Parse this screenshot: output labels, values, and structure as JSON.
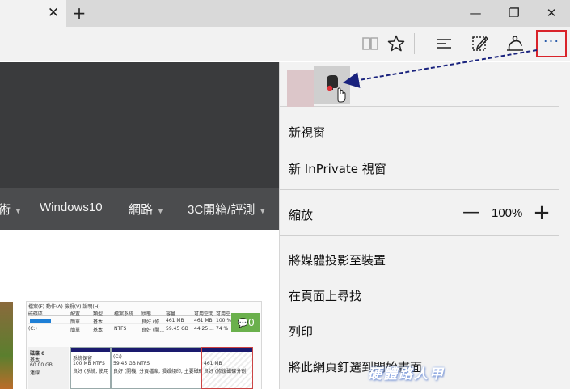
{
  "tabbar": {
    "close_glyph": "✕",
    "new_tab_glyph": "+",
    "minimize_glyph": "—",
    "restore_glyph": "❐",
    "close_window_glyph": "✕"
  },
  "toolbar": {
    "icons": [
      "reading-view-icon",
      "favorites-star-icon",
      "hub-icon",
      "web-note-icon",
      "share-icon"
    ],
    "more_glyph": "···"
  },
  "page": {
    "nav_items": [
      "術",
      "Windows10",
      "網路",
      "3C開箱/評測"
    ],
    "comment_count": "0",
    "article_image": {
      "menu": "檔案(F)  動作(A)  檢視(V)  說明(H)",
      "headers": [
        "磁碟區",
        "配置",
        "類型",
        "檔案系統",
        "狀態",
        "容量",
        "可用空間",
        "可用空..."
      ],
      "rows": [
        [
          "",
          "簡單",
          "基本",
          "",
          "良好 (修...",
          "461 MB",
          "461 MB",
          "100 %"
        ],
        [
          "(C:)",
          "簡單",
          "基本",
          "NTFS",
          "良好 (開...",
          "59.45 GB",
          "44.25 ...",
          "74 %"
        ]
      ],
      "disk": {
        "name": "磁碟 0",
        "type": "基本",
        "size": "60.00 GB",
        "status": "連線"
      },
      "partitions": [
        {
          "title": "系統保留",
          "size": "100 MB NTFS",
          "status": "良好 (系統, 使用"
        },
        {
          "title": "(C:)",
          "size": "59.45 GB NTFS",
          "status": "良好 (開機, 分頁檔案, 損毀傾印, 主要磁碟分"
        },
        {
          "title": "",
          "size": "461 MB",
          "status": "良好 (修復磁碟分割)"
        }
      ]
    }
  },
  "menu": {
    "new_window": "新視窗",
    "new_inprivate": "新 InPrivate 視窗",
    "zoom_label": "縮放",
    "zoom_minus": "—",
    "zoom_value": "100%",
    "zoom_plus": "+",
    "cast": "將媒體投影至裝置",
    "find": "在頁面上尋找",
    "print": "列印",
    "pin": "將此網頁釘選到開始畫面"
  },
  "watermark": "硬體路人甲",
  "colors": {
    "highlight_border": "#d9232a",
    "arrow": "#1a237e",
    "badge": "#6ab04c",
    "header_dark": "#3a3b3d"
  }
}
